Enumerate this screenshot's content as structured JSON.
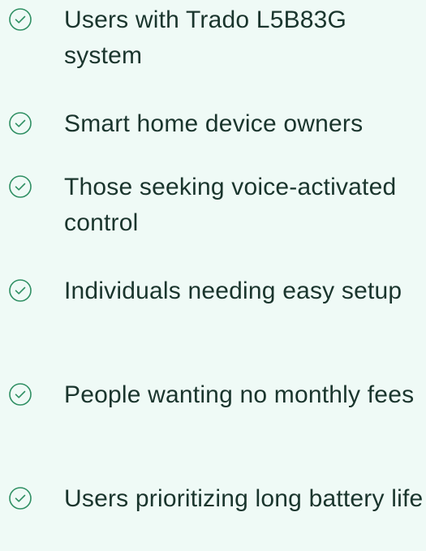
{
  "accent_color": "#2f8f63",
  "background_color": "#effaf6",
  "text_color": "#1a352d",
  "icon": "check-circle-icon",
  "items": [
    {
      "label": "Users with Trado L5B83G system"
    },
    {
      "label": "Smart home device owners"
    },
    {
      "label": "Those seeking voice-activated control"
    },
    {
      "label": "Individuals needing easy setup"
    },
    {
      "label": "People wanting no monthly fees"
    },
    {
      "label": "Users prioritizing long battery life"
    }
  ]
}
